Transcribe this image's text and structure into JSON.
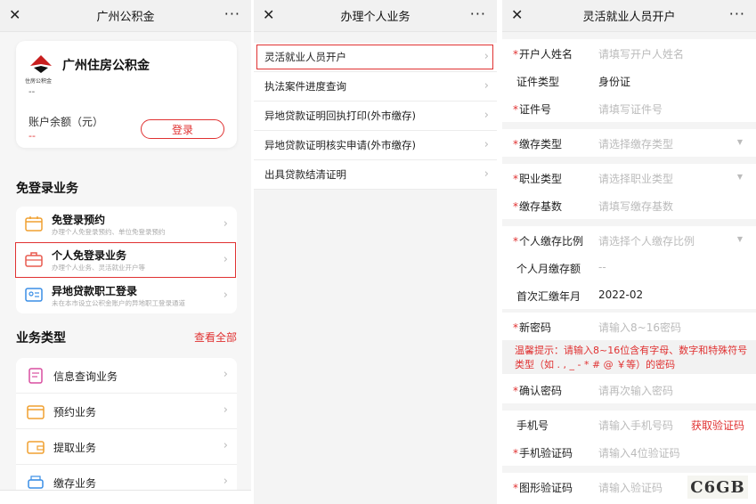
{
  "panel1": {
    "title": "广州公积金",
    "card": {
      "brand": "广州住房公积金",
      "logo_sub": "住房公积金",
      "account_dash": "--",
      "balance_label": "账户余额（元）",
      "balance_value": "--",
      "login_label": "登录"
    },
    "section1_title": "免登录业务",
    "free_services": [
      {
        "title": "免登录预约",
        "desc": "办理个人免登录预约、单位免登录预约"
      },
      {
        "title": "个人免登录业务",
        "desc": "办理个人业务、灵活就业开户等"
      },
      {
        "title": "异地贷款职工登录",
        "desc": "未在本市设立公积金账户的异地职工登录通道"
      }
    ],
    "section2_title": "业务类型",
    "view_all": "查看全部",
    "business_types": [
      {
        "title": "信息查询业务"
      },
      {
        "title": "预约业务"
      },
      {
        "title": "提取业务"
      },
      {
        "title": "缴存业务"
      }
    ]
  },
  "panel2": {
    "title": "办理个人业务",
    "menu": [
      "灵活就业人员开户",
      "执法案件进度查询",
      "异地贷款证明回执打印(外市缴存)",
      "异地贷款证明核实申请(外市缴存)",
      "出具贷款结清证明"
    ]
  },
  "panel3": {
    "title": "灵活就业人员开户",
    "fields": {
      "name": {
        "label": "开户人姓名",
        "placeholder": "请填写开户人姓名"
      },
      "id_type": {
        "label": "证件类型",
        "value": "身份证"
      },
      "id_no": {
        "label": "证件号",
        "placeholder": "请填写证件号"
      },
      "deposit_type": {
        "label": "缴存类型",
        "placeholder": "请选择缴存类型"
      },
      "job_type": {
        "label": "职业类型",
        "placeholder": "请选择职业类型"
      },
      "deposit_base": {
        "label": "缴存基数",
        "placeholder": "请填写缴存基数"
      },
      "ratio": {
        "label": "个人缴存比例",
        "placeholder": "请选择个人缴存比例"
      },
      "monthly": {
        "label": "个人月缴存额",
        "value": "--"
      },
      "first_month": {
        "label": "首次汇缴年月",
        "value": "2022-02"
      },
      "new_pwd": {
        "label": "新密码",
        "placeholder": "请输入8~16密码"
      },
      "tip": "温馨提示：请输入8~16位含有字母、数字和特殊符号类型（如 . , _ - * # @ ￥等）的密码",
      "confirm_pwd": {
        "label": "确认密码",
        "placeholder": "请再次输入密码"
      },
      "phone": {
        "label": "手机号",
        "placeholder": "请输入手机号码",
        "action": "获取验证码"
      },
      "sms_code": {
        "label": "手机验证码",
        "placeholder": "请输入4位验证码"
      },
      "img_code": {
        "label": "图形验证码",
        "placeholder": "请输入验证码",
        "captcha": "C6GB"
      }
    }
  },
  "common": {
    "close": "✕",
    "more": "···",
    "chevron": "›",
    "required": "*",
    "dropdown": "▼"
  },
  "colors": {
    "accent": "#e03131",
    "placeholder": "#bbbbbb"
  }
}
